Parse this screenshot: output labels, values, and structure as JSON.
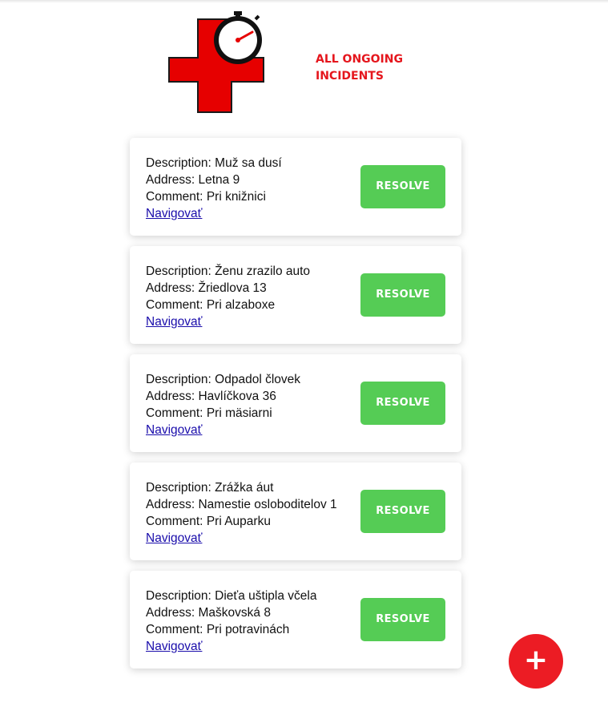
{
  "header": {
    "logo_icon": "red-cross-stopwatch-icon",
    "title": "ALL ONGOING INCIDENTS"
  },
  "labels": {
    "description": "Description:",
    "address": "Address:",
    "comment": "Comment:"
  },
  "incidents": [
    {
      "description": "Muž sa dusí",
      "address": "Letna 9",
      "comment": "Pri knižnici",
      "navigate_label": "Navigovať",
      "resolve_label": "RESOLVE"
    },
    {
      "description": "Ženu zrazilo auto",
      "address": "Žriedlova 13",
      "comment": "Pri alzaboxe",
      "navigate_label": "Navigovať",
      "resolve_label": "RESOLVE"
    },
    {
      "description": "Odpadol človek",
      "address": "Havlíčkova 36",
      "comment": "Pri mäsiarni",
      "navigate_label": "Navigovať",
      "resolve_label": "RESOLVE"
    },
    {
      "description": "Zrážka áut",
      "address": "Namestie osloboditelov 1",
      "comment": "Pri Auparku",
      "navigate_label": "Navigovať",
      "resolve_label": "RESOLVE"
    },
    {
      "description": "Dieťa uštipla včela",
      "address": "Maškovská 8",
      "comment": "Pri potravinách",
      "navigate_label": "Navigovať",
      "resolve_label": "RESOLVE"
    }
  ],
  "fab": {
    "icon": "plus-icon",
    "label": "+"
  },
  "colors": {
    "accent_red": "#e5161d",
    "resolve_green": "#55cc55",
    "link_blue": "#1a0dab"
  }
}
